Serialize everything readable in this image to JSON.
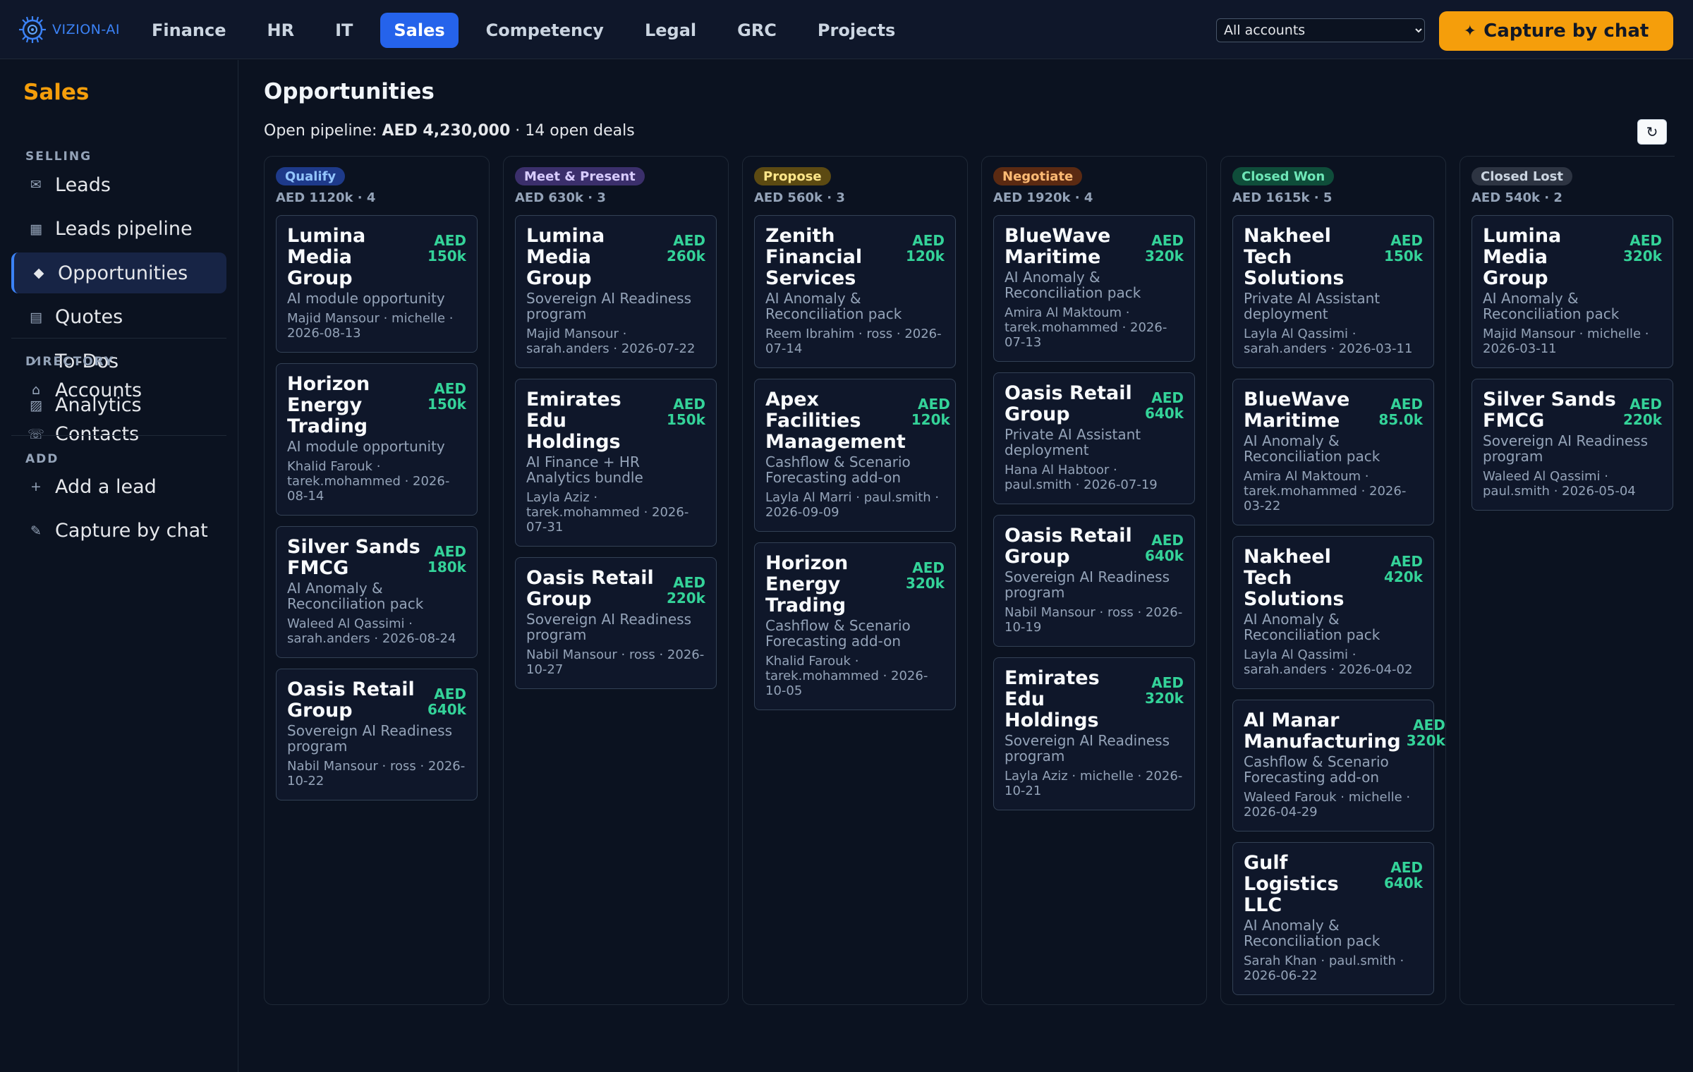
{
  "brand": {
    "name": "VIZION-AI"
  },
  "topnav": {
    "tabs": [
      {
        "label": "Finance"
      },
      {
        "label": "HR"
      },
      {
        "label": "IT"
      },
      {
        "label": "Sales",
        "active": true
      },
      {
        "label": "Competency"
      },
      {
        "label": "Legal"
      },
      {
        "label": "GRC"
      },
      {
        "label": "Projects"
      }
    ],
    "account_select": "All accounts",
    "capture_label": "Capture by chat"
  },
  "sidebar": {
    "title": "Sales",
    "sections": [
      {
        "label": "SELLING",
        "items": [
          {
            "label": "Leads",
            "icon": "mail-icon"
          },
          {
            "label": "Leads pipeline",
            "icon": "grid-icon"
          },
          {
            "label": "Opportunities",
            "icon": "diamond-icon",
            "active": true
          },
          {
            "label": "Quotes",
            "icon": "list-icon"
          },
          {
            "label": "To-Dos",
            "icon": "check-icon"
          },
          {
            "label": "Analytics",
            "icon": "chart-icon"
          }
        ]
      },
      {
        "label": "DIRECTORY",
        "items": [
          {
            "label": "Accounts",
            "icon": "home-icon"
          },
          {
            "label": "Contacts",
            "icon": "phone-icon"
          }
        ]
      },
      {
        "label": "ADD",
        "items": [
          {
            "label": "Add a lead",
            "icon": "plus-icon"
          },
          {
            "label": "Capture by chat",
            "icon": "pencil-icon"
          }
        ]
      }
    ]
  },
  "main": {
    "title": "Opportunities",
    "summary": {
      "prefix": "Open pipeline:",
      "value": "AED 4,230,000",
      "suffix": "· 14 open deals"
    },
    "refresh_icon": "↻"
  },
  "columns": [
    {
      "stage": "Qualify",
      "badge_bg": "#1e3a8a",
      "badge_fg": "#93c5fd",
      "meta": "AED 1120k · 4",
      "cards": [
        {
          "name": "Lumina Media Group",
          "amount": "AED\n150k",
          "product": "AI module opportunity",
          "meta": "Majid Mansour · michelle · 2026-08-13"
        },
        {
          "name": "Horizon Energy Trading",
          "amount": "AED\n150k",
          "product": "AI module opportunity",
          "meta": "Khalid Farouk · tarek.mohammed · 2026-08-14"
        },
        {
          "name": "Silver Sands FMCG",
          "amount": "AED\n180k",
          "product": "AI Anomaly & Reconciliation pack",
          "meta": "Waleed Al Qassimi · sarah.anders · 2026-08-24"
        },
        {
          "name": "Oasis Retail Group",
          "amount": "AED\n640k",
          "product": "Sovereign AI Readiness program",
          "meta": "Nabil Mansour · ross · 2026-10-22"
        }
      ]
    },
    {
      "stage": "Meet & Present",
      "badge_bg": "#3b2f6b",
      "badge_fg": "#d8ccff",
      "meta": "AED 630k · 3",
      "cards": [
        {
          "name": "Lumina Media Group",
          "amount": "AED\n260k",
          "product": "Sovereign AI Readiness program",
          "meta": "Majid Mansour · sarah.anders · 2026-07-22"
        },
        {
          "name": "Emirates Edu Holdings",
          "amount": "AED\n150k",
          "product": "AI Finance + HR Analytics bundle",
          "meta": "Layla Aziz · tarek.mohammed · 2026-07-31"
        },
        {
          "name": "Oasis Retail Group",
          "amount": "AED\n220k",
          "product": "Sovereign AI Readiness program",
          "meta": "Nabil Mansour · ross · 2026-10-27"
        }
      ]
    },
    {
      "stage": "Propose",
      "badge_bg": "#5c4a12",
      "badge_fg": "#fde68a",
      "meta": "AED 560k · 3",
      "cards": [
        {
          "name": "Zenith Financial Services",
          "amount": "AED\n120k",
          "product": "AI Anomaly & Reconciliation pack",
          "meta": "Reem Ibrahim · ross · 2026-07-14"
        },
        {
          "name": "Apex Facilities Management",
          "amount": "AED\n120k",
          "product": "Cashflow & Scenario Forecasting add-on",
          "meta": "Layla Al Marri · paul.smith · 2026-09-09"
        },
        {
          "name": "Horizon Energy Trading",
          "amount": "AED\n320k",
          "product": "Cashflow & Scenario Forecasting add-on",
          "meta": "Khalid Farouk · tarek.mohammed · 2026-10-05"
        }
      ]
    },
    {
      "stage": "Negotiate",
      "badge_bg": "#5b2a12",
      "badge_fg": "#fdba74",
      "meta": "AED 1920k · 4",
      "cards": [
        {
          "name": "BlueWave Maritime",
          "amount": "AED\n320k",
          "product": "AI Anomaly & Reconciliation pack",
          "meta": "Amira Al Maktoum · tarek.mohammed · 2026-07-13"
        },
        {
          "name": "Oasis Retail Group",
          "amount": "AED\n640k",
          "product": "Private AI Assistant deployment",
          "meta": "Hana Al Habtoor · paul.smith · 2026-07-19"
        },
        {
          "name": "Oasis Retail Group",
          "amount": "AED\n640k",
          "product": "Sovereign AI Readiness program",
          "meta": "Nabil Mansour · ross · 2026-10-19"
        },
        {
          "name": "Emirates Edu Holdings",
          "amount": "AED\n320k",
          "product": "Sovereign AI Readiness program",
          "meta": "Layla Aziz · michelle · 2026-10-21"
        }
      ]
    },
    {
      "stage": "Closed Won",
      "badge_bg": "#0f4d3a",
      "badge_fg": "#6ee7b7",
      "meta": "AED 1615k · 5",
      "cards": [
        {
          "name": "Nakheel Tech Solutions",
          "amount": "AED\n150k",
          "product": "Private AI Assistant deployment",
          "meta": "Layla Al Qassimi · sarah.anders · 2026-03-11"
        },
        {
          "name": "BlueWave Maritime",
          "amount": "AED\n85.0k",
          "product": "AI Anomaly & Reconciliation pack",
          "meta": "Amira Al Maktoum · tarek.mohammed · 2026-03-22"
        },
        {
          "name": "Nakheel Tech Solutions",
          "amount": "AED\n420k",
          "product": "AI Anomaly & Reconciliation pack",
          "meta": "Layla Al Qassimi · sarah.anders · 2026-04-02"
        },
        {
          "name": "Al Manar Manufacturing",
          "amount": "AED\n320k",
          "product": "Cashflow & Scenario Forecasting add-on",
          "meta": "Waleed Farouk · michelle · 2026-04-29"
        },
        {
          "name": "Gulf Logistics LLC",
          "amount": "AED\n640k",
          "product": "AI Anomaly & Reconciliation pack",
          "meta": "Sarah Khan · paul.smith · 2026-06-22"
        }
      ]
    },
    {
      "stage": "Closed Lost",
      "badge_bg": "#2d3442",
      "badge_fg": "#cbd5e1",
      "meta": "AED 540k · 2",
      "cards": [
        {
          "name": "Lumina Media Group",
          "amount": "AED\n320k",
          "product": "AI Anomaly & Reconciliation pack",
          "meta": "Majid Mansour · michelle · 2026-03-11"
        },
        {
          "name": "Silver Sands FMCG",
          "amount": "AED\n220k",
          "product": "Sovereign AI Readiness program",
          "meta": "Waleed Al Qassimi · paul.smith · 2026-05-04"
        }
      ]
    }
  ]
}
